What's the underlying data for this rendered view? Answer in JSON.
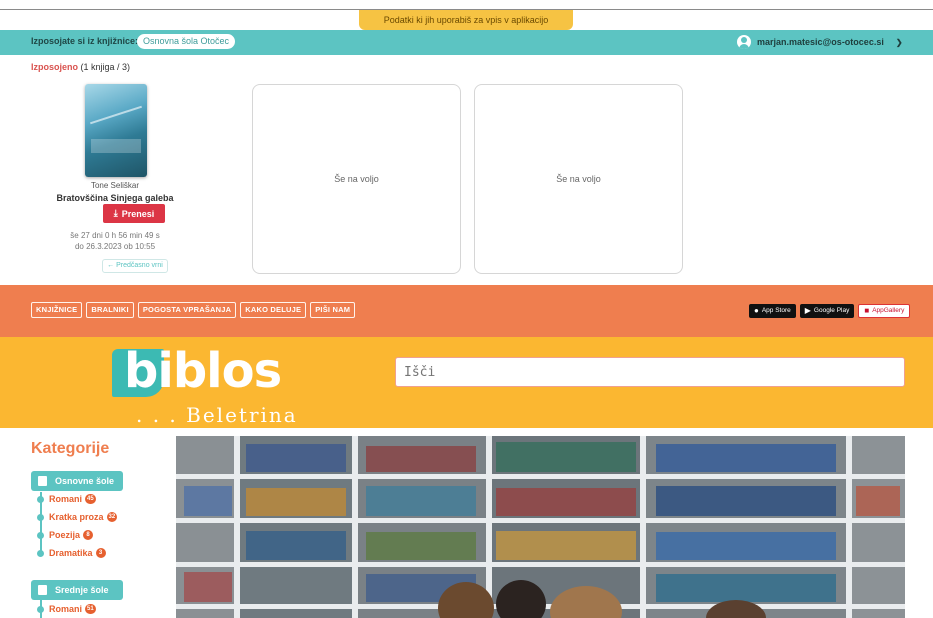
{
  "notice": "Podatki ki jih uporabiš za vpis v aplikacijo",
  "library": {
    "label": "Izposojate si iz knjižnice:",
    "selected": "Osnovna šola Otočec"
  },
  "user": {
    "email": "marjan.matesic@os-otocec.si"
  },
  "borrowed": {
    "label": "Izposojeno",
    "detail": "(1 knjiga / 3)"
  },
  "book": {
    "author": "Tone Seliškar",
    "title": "Bratovščina Sinjega galeba",
    "download_label": "Prenesi",
    "remaining": "še 27 dni 0 h 56 min 49 s",
    "due": "do 26.3.2023 ob 10:55",
    "return_label": "← Predčasno vrni"
  },
  "slots": [
    "Še na voljo",
    "Še na voljo"
  ],
  "nav": [
    "KNJIŽNICE",
    "BRALNIKI",
    "POGOSTA VPRAŠANJA",
    "KAKO DELUJE",
    "PIŠI NAM"
  ],
  "stores": [
    {
      "label": "App Store",
      "icon": "apple-icon"
    },
    {
      "label": "Google Play",
      "icon": "play-icon"
    },
    {
      "label": "AppGallery",
      "icon": "huawei-icon"
    }
  ],
  "brand": {
    "name": "biblos",
    "sub": ". . . Beletrina"
  },
  "search": {
    "placeholder": "Išči"
  },
  "categories": {
    "title": "Kategorije",
    "groups": [
      {
        "label": "Osnovne šole",
        "items": [
          {
            "label": "Romani",
            "count": "45"
          },
          {
            "label": "Kratka proza",
            "count": "32"
          },
          {
            "label": "Poezija",
            "count": "8"
          },
          {
            "label": "Dramatika",
            "count": "3"
          }
        ]
      },
      {
        "label": "Srednje šole",
        "items": [
          {
            "label": "Romani",
            "count": "51"
          }
        ]
      }
    ]
  },
  "colors": {
    "teal": "#5cc4c2",
    "orange": "#ef7e4f",
    "yellow": "#fbb731",
    "red": "#dc3545"
  }
}
